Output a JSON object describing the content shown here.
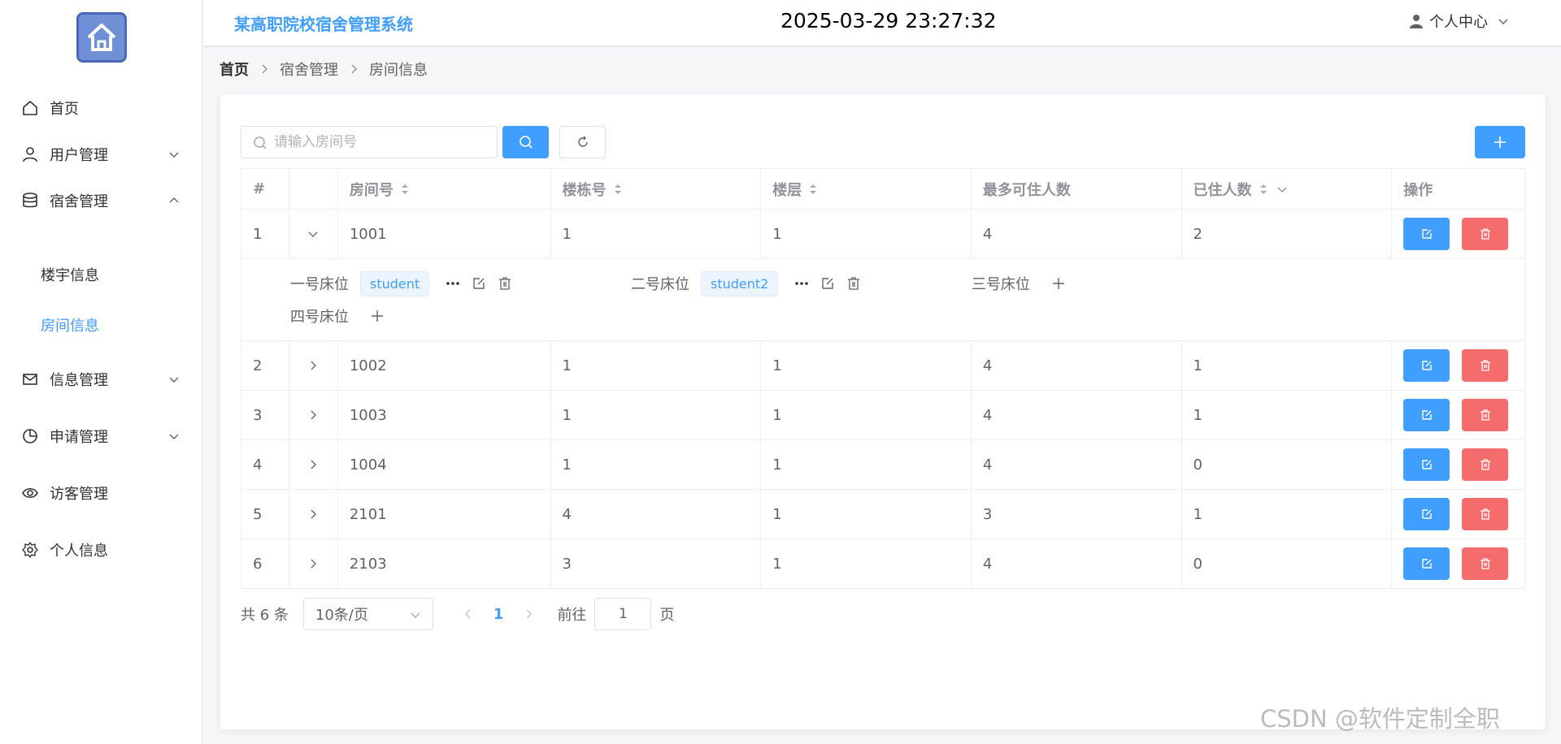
{
  "app": {
    "title": "某高职院校宿舍管理系统",
    "clock": "2025-03-29 23:27:32"
  },
  "user_menu": {
    "label": "个人中心"
  },
  "sidebar": {
    "items": [
      {
        "label": "首页",
        "icon": "home-icon"
      },
      {
        "label": "用户管理",
        "icon": "user-icon",
        "expandable": true
      },
      {
        "label": "宿舍管理",
        "icon": "database-icon",
        "expandable": true,
        "expanded": true
      },
      {
        "label": "信息管理",
        "icon": "mail-icon",
        "expandable": true
      },
      {
        "label": "申请管理",
        "icon": "pie-chart-icon",
        "expandable": true
      },
      {
        "label": "访客管理",
        "icon": "eye-icon"
      },
      {
        "label": "个人信息",
        "icon": "gear-icon"
      }
    ],
    "sub_items": [
      {
        "label": "楼宇信息"
      },
      {
        "label": "房间信息",
        "active": true
      }
    ]
  },
  "breadcrumb": {
    "home": "首页",
    "level1": "宿舍管理",
    "level2": "房间信息"
  },
  "search": {
    "placeholder": "请输入房间号",
    "value": ""
  },
  "table": {
    "headers": [
      "#",
      "",
      "房间号",
      "楼栋号",
      "楼层",
      "最多可住人数",
      "已住人数",
      "操作"
    ],
    "rows": [
      {
        "idx": "1",
        "room": "1001",
        "building": "1",
        "floor": "1",
        "max": "4",
        "occupied": "2",
        "expanded": true
      },
      {
        "idx": "2",
        "room": "1002",
        "building": "1",
        "floor": "1",
        "max": "4",
        "occupied": "1"
      },
      {
        "idx": "3",
        "room": "1003",
        "building": "1",
        "floor": "1",
        "max": "4",
        "occupied": "1"
      },
      {
        "idx": "4",
        "room": "1004",
        "building": "1",
        "floor": "1",
        "max": "4",
        "occupied": "0"
      },
      {
        "idx": "5",
        "room": "2101",
        "building": "4",
        "floor": "1",
        "max": "3",
        "occupied": "1"
      },
      {
        "idx": "6",
        "room": "2103",
        "building": "3",
        "floor": "1",
        "max": "4",
        "occupied": "0"
      }
    ]
  },
  "beds": [
    {
      "label": "一号床位",
      "student": "student"
    },
    {
      "label": "二号床位",
      "student": "student2"
    },
    {
      "label": "三号床位",
      "student": ""
    },
    {
      "label": "四号床位",
      "student": ""
    }
  ],
  "pagination": {
    "total": "共 6 条",
    "page_size": "10条/页",
    "current_page": "1",
    "goto_label": "前往",
    "goto_value": "1",
    "goto_suffix": "页"
  },
  "watermark": "CSDN @软件定制全职",
  "colors": {
    "primary": "#409eff",
    "danger": "#f56c6c",
    "text": "#606266",
    "header_text": "#909399"
  }
}
